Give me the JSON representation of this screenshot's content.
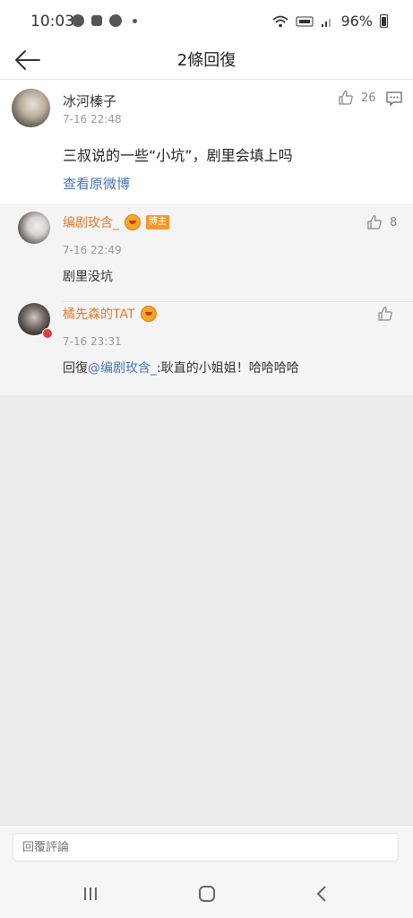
{
  "status": {
    "time": "10:03",
    "battery": "96%"
  },
  "nav": {
    "title": "2條回復"
  },
  "main_comment": {
    "name": "冰河榛子",
    "time": "7-16 22:48",
    "likes": "26",
    "text": "三叔说的一些“小坑”，剧里会填上吗",
    "view_original": "查看原微博"
  },
  "replies": [
    {
      "name": "编剧玫含_",
      "badge": "博主",
      "time": "7-16 22:49",
      "likes": "8",
      "text": "剧里没坑"
    },
    {
      "name": "橘先森的TAT",
      "time": "7-16 23:31",
      "text_prefix": "回復",
      "mention": "@编剧玫含_",
      "text_rest": ":耿直的小姐姐！哈哈哈哈"
    }
  ],
  "bottom": {
    "placeholder": "回覆評論"
  },
  "colors": {
    "accent_orange": "#e7792b",
    "link_blue": "#4a73b0"
  }
}
